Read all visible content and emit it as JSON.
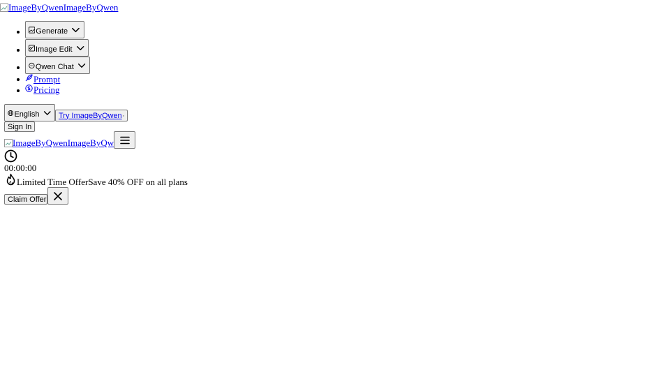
{
  "header": {
    "logo_alt": "ImageByQwen",
    "logo_text": "ImageByQwen"
  },
  "nav": {
    "generate": "Generate",
    "image_edit": "Image Edit",
    "qwen_chat": "Qwen Chat",
    "prompt": "Prompt",
    "pricing": "Pricing"
  },
  "actions": {
    "language": "English",
    "try_label": "Try ImageByQwen",
    "sign_in": "Sign In"
  },
  "mobile_header": {
    "logo_alt": "ImageByQwen",
    "logo_text": "ImageByQwen"
  },
  "offer": {
    "countdown": "00:00:00",
    "title": "Limited Time Offer",
    "subtitle": "Save 40% OFF on all plans",
    "claim_label": "Claim Offer"
  },
  "icons": {
    "generate": "image-icon",
    "image_edit": "image-edit-icon",
    "qwen_chat": "chat-bubble-icon",
    "prompt": "feather-pen-icon",
    "pricing": "dollar-circle-icon",
    "language": "globe-icon",
    "try": "sparkles-icon",
    "menu": "hamburger-menu-icon",
    "timer": "clock-icon",
    "offer": "flame-icon",
    "close": "close-icon"
  }
}
